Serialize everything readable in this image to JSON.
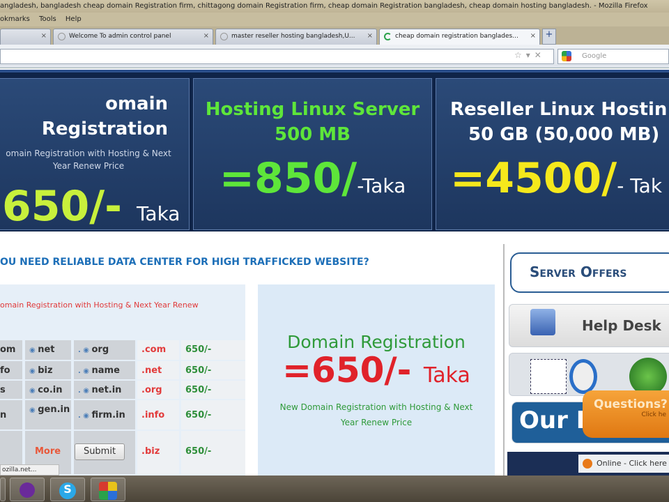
{
  "browser": {
    "title": "angladesh, bangladesh cheap domain Registration firm, chittagong domain Registration firm, cheap domain Registration bangladesh, cheap domain hosting bangladesh. - Mozilla Firefox",
    "menu": [
      "okmarks",
      "Tools",
      "Help"
    ],
    "tabs": [
      "",
      "Welcome To admin control panel",
      "master reseller hosting bangladesh,U...",
      "cheap domain registration banglades..."
    ],
    "search_placeholder": "Google",
    "status": "ozilla.net..."
  },
  "banner": [
    {
      "title": "omain Registration",
      "sub": "omain Registration with Hosting & Next Year Renew Price",
      "price": "650/-",
      "unit": "Taka",
      "color": "#c8f03c"
    },
    {
      "title": "Hosting Linux Server",
      "title2": "500 MB",
      "price": "=850/",
      "unit": "-Taka",
      "color": "#5ee63a"
    },
    {
      "title": "Reseller Linux Hostin",
      "title2": "50 GB (50,000 MB)",
      "price": "=4500/",
      "unit": "- Tak",
      "color": "#f5e81c"
    }
  ],
  "heading": "OU NEED RELIABLE DATA CENTER FOR HIGH TRAFFICKED WEBSITE?",
  "left_note": "omain Registration with Hosting & Next Year Renew",
  "table": [
    {
      "c1": "om",
      "c2": "net",
      "c3": "org",
      "ext": ".com",
      "price": "650/-"
    },
    {
      "c1": "fo",
      "c2": "biz",
      "c3": "name",
      "ext": ".net",
      "price": "650/-"
    },
    {
      "c1": "s",
      "c2": "co.in",
      "c3": "net.in",
      "ext": ".org",
      "price": "650/-"
    },
    {
      "c1": "n",
      "c2": "gen.in",
      "c3": "firm.in",
      "ext": ".info",
      "price": "650/-"
    },
    {
      "c1": "",
      "c2": "More",
      "c3": "Submit",
      "ext": ".biz",
      "price": "650/-"
    }
  ],
  "promo": {
    "title": "Domain Registration",
    "price": "=650/-",
    "unit": "Taka",
    "sub": "New Domain Registration with Hosting & Next Year Renew Price"
  },
  "sidebar": {
    "server_offers": "Server Offers",
    "help_desk": "Help Desk",
    "our": "Our F",
    "questions": "Questions?",
    "click": "Click he",
    "online": "Online - Click here"
  }
}
